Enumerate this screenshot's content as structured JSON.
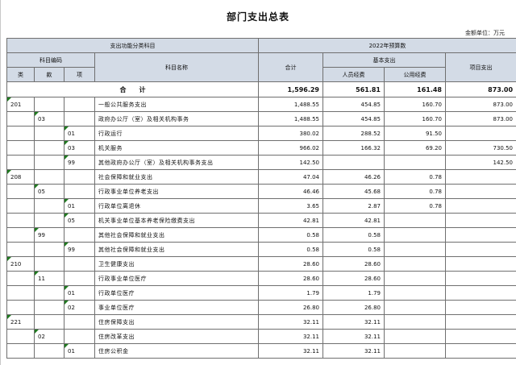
{
  "title": "部门支出总表",
  "unit": "金额单位：万元",
  "header": {
    "func_class": "支出功能分类科目",
    "budget_year": "2022年预算数",
    "subject_code": "科目编码",
    "class": "类",
    "section": "款",
    "item": "项",
    "subject_name": "科目名称",
    "total": "合计",
    "basic_expense": "基本支出",
    "personnel": "人员经费",
    "public": "公用经费",
    "project": "项目支出"
  },
  "total_row": {
    "label": "合　　计",
    "total": "1,596.29",
    "personnel": "561.81",
    "public": "161.48",
    "project": "873.00"
  },
  "rows": [
    {
      "lei": "201",
      "kuan": "",
      "xiang": "",
      "name": "一般公共服务支出",
      "total": "1,488.55",
      "personnel": "454.85",
      "public": "160.70",
      "project": "873.00"
    },
    {
      "lei": "",
      "kuan": "03",
      "xiang": "",
      "name": "政府办公厅（室）及相关机构事务",
      "total": "1,488.55",
      "personnel": "454.85",
      "public": "160.70",
      "project": "873.00"
    },
    {
      "lei": "",
      "kuan": "",
      "xiang": "01",
      "name": "行政运行",
      "total": "380.02",
      "personnel": "288.52",
      "public": "91.50",
      "project": ""
    },
    {
      "lei": "",
      "kuan": "",
      "xiang": "03",
      "name": "机关服务",
      "total": "966.02",
      "personnel": "166.32",
      "public": "69.20",
      "project": "730.50"
    },
    {
      "lei": "",
      "kuan": "",
      "xiang": "99",
      "name": "其他政府办公厅（室）及相关机构事务支出",
      "total": "142.50",
      "personnel": "",
      "public": "",
      "project": "142.50"
    },
    {
      "lei": "208",
      "kuan": "",
      "xiang": "",
      "name": "社会保障和就业支出",
      "total": "47.04",
      "personnel": "46.26",
      "public": "0.78",
      "project": ""
    },
    {
      "lei": "",
      "kuan": "05",
      "xiang": "",
      "name": "行政事业单位养老支出",
      "total": "46.46",
      "personnel": "45.68",
      "public": "0.78",
      "project": ""
    },
    {
      "lei": "",
      "kuan": "",
      "xiang": "01",
      "name": "行政单位离退休",
      "total": "3.65",
      "personnel": "2.87",
      "public": "0.78",
      "project": ""
    },
    {
      "lei": "",
      "kuan": "",
      "xiang": "05",
      "name": "机关事业单位基本养老保险缴费支出",
      "total": "42.81",
      "personnel": "42.81",
      "public": "",
      "project": ""
    },
    {
      "lei": "",
      "kuan": "99",
      "xiang": "",
      "name": "其他社会保障和就业支出",
      "total": "0.58",
      "personnel": "0.58",
      "public": "",
      "project": ""
    },
    {
      "lei": "",
      "kuan": "",
      "xiang": "99",
      "name": "其他社会保障和就业支出",
      "total": "0.58",
      "personnel": "0.58",
      "public": "",
      "project": ""
    },
    {
      "lei": "210",
      "kuan": "",
      "xiang": "",
      "name": "卫生健康支出",
      "total": "28.60",
      "personnel": "28.60",
      "public": "",
      "project": ""
    },
    {
      "lei": "",
      "kuan": "11",
      "xiang": "",
      "name": "行政事业单位医疗",
      "total": "28.60",
      "personnel": "28.60",
      "public": "",
      "project": ""
    },
    {
      "lei": "",
      "kuan": "",
      "xiang": "01",
      "name": "行政单位医疗",
      "total": "1.79",
      "personnel": "1.79",
      "public": "",
      "project": ""
    },
    {
      "lei": "",
      "kuan": "",
      "xiang": "02",
      "name": "事业单位医疗",
      "total": "26.80",
      "personnel": "26.80",
      "public": "",
      "project": ""
    },
    {
      "lei": "221",
      "kuan": "",
      "xiang": "",
      "name": "住房保障支出",
      "total": "32.11",
      "personnel": "32.11",
      "public": "",
      "project": ""
    },
    {
      "lei": "",
      "kuan": "02",
      "xiang": "",
      "name": "住房改革支出",
      "total": "32.11",
      "personnel": "32.11",
      "public": "",
      "project": ""
    },
    {
      "lei": "",
      "kuan": "",
      "xiang": "01",
      "name": "住房公积金",
      "total": "32.11",
      "personnel": "32.11",
      "public": "",
      "project": ""
    }
  ]
}
